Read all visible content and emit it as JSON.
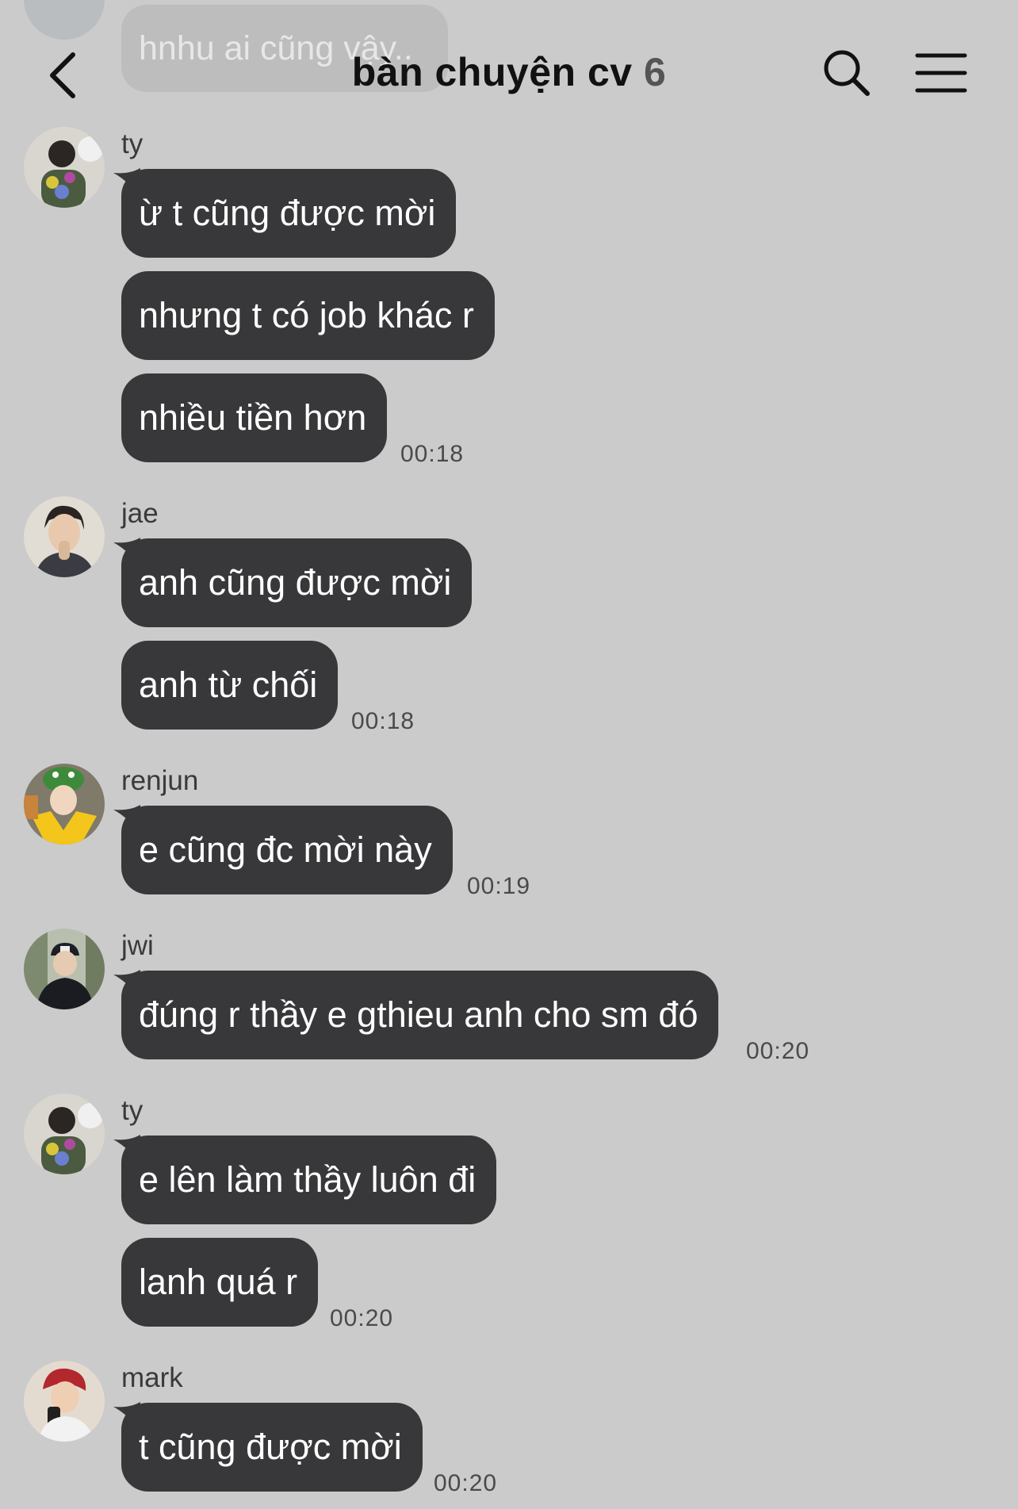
{
  "header": {
    "title": "bàn chuyện cv",
    "member_count": "6"
  },
  "previous_message": {
    "text": "hnhu ai cũng vậy.."
  },
  "groups": [
    {
      "sender": "ty",
      "messages": [
        "ừ t cũng được mời",
        "nhưng t có job khác r",
        "nhiều tiền hơn"
      ],
      "time": "00:18"
    },
    {
      "sender": "jae",
      "messages": [
        "anh cũng được mời",
        "anh từ chối"
      ],
      "time": "00:18"
    },
    {
      "sender": "renjun",
      "messages": [
        "e cũng đc mời này"
      ],
      "time": "00:19"
    },
    {
      "sender": "jwi",
      "messages": [
        "đúng r thầy e gthieu anh cho sm đó"
      ],
      "time": "00:20"
    },
    {
      "sender": "ty",
      "messages": [
        "e lên làm thầy luôn đi",
        "lanh quá r"
      ],
      "time": "00:20"
    },
    {
      "sender": "mark",
      "messages": [
        "t cũng được mời"
      ],
      "time": "00:20"
    }
  ],
  "colors": {
    "background": "#cbcbcb",
    "bubble": "#38383a",
    "bubble_text": "#ffffff"
  }
}
